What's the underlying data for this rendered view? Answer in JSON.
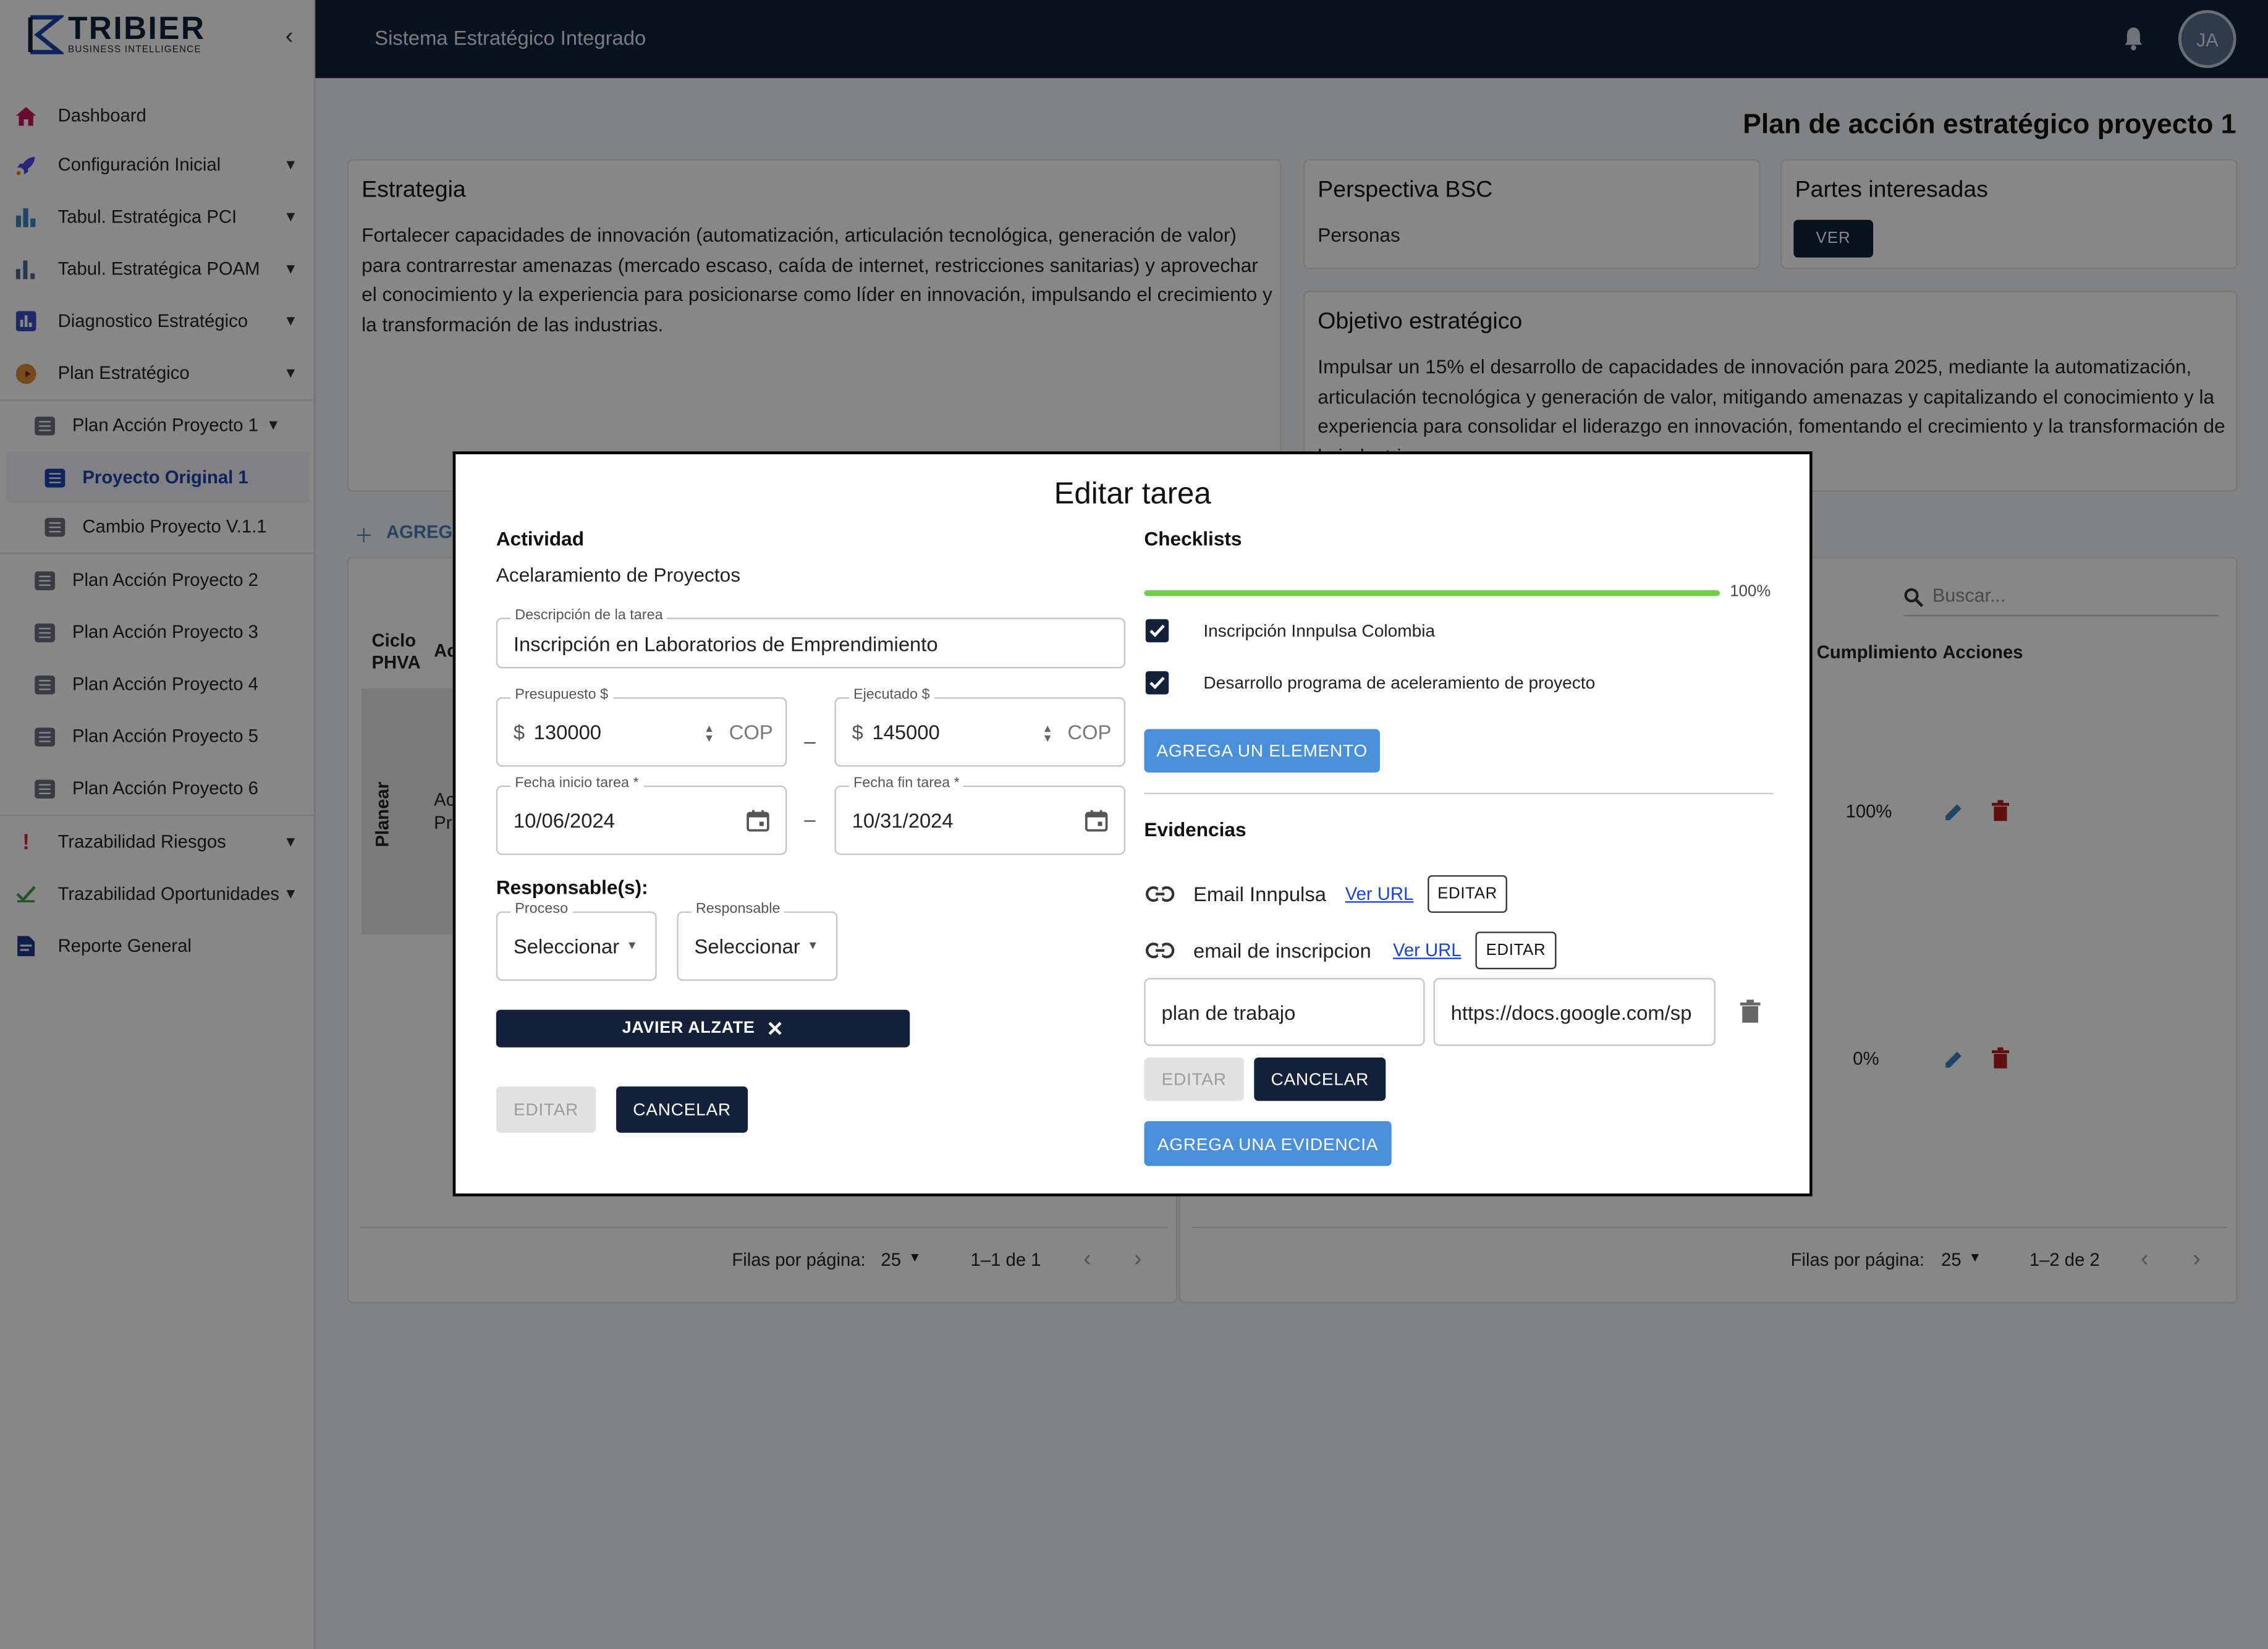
{
  "app": {
    "logo_name": "TRIBIER",
    "logo_sub": "BUSINESS INTELLIGENCE",
    "top_title": "Sistema Estratégico Integrado",
    "avatar_initials": "JA"
  },
  "sidebar": {
    "items": [
      {
        "label": "Dashboard"
      },
      {
        "label": "Configuración Inicial"
      },
      {
        "label": "Tabul. Estratégica PCI"
      },
      {
        "label": "Tabul. Estratégica POAM"
      },
      {
        "label": "Diagnostico Estratégico"
      },
      {
        "label": "Plan Estratégico"
      },
      {
        "label": "Plan Acción Proyecto 1"
      },
      {
        "label": "Proyecto Original 1"
      },
      {
        "label": "Cambio Proyecto V.1.1"
      },
      {
        "label": "Plan Acción Proyecto 2"
      },
      {
        "label": "Plan Acción Proyecto 3"
      },
      {
        "label": "Plan Acción Proyecto 4"
      },
      {
        "label": "Plan Acción Proyecto 5"
      },
      {
        "label": "Plan Acción Proyecto 6"
      },
      {
        "label": "Trazabilidad Riesgos"
      },
      {
        "label": "Trazabilidad Oportunidades"
      },
      {
        "label": "Reporte General"
      }
    ]
  },
  "main": {
    "page_title": "Plan de acción estratégico proyecto 1",
    "estrategia": {
      "title": "Estrategia",
      "text": "Fortalecer capacidades de innovación (automatización, articulación tecnológica, generación de valor) para contrarrestar amenazas (mercado escaso, caída de internet, restricciones sanitarias) y aprovechar el conocimiento y la experiencia para posicionarse como líder en innovación, impulsando el crecimiento y la transformación de las industrias."
    },
    "perspectiva": {
      "title": "Perspectiva BSC",
      "value": "Personas"
    },
    "partes": {
      "title": "Partes interesadas",
      "button": "VER"
    },
    "objetivo": {
      "title": "Objetivo estratégico",
      "text": "Impulsar un 15% el desarrollo de capacidades de innovación para 2025, mediante la automatización, articulación tecnológica y generación de valor, mitigando amenazas y capitalizando el conocimiento y la experiencia para consolidar el liderazgo en innovación, fomentando el crecimiento y la transformación de la industria."
    },
    "add_label": "AGREGA",
    "left_table": {
      "col_ciclo": "Ciclo PHVA",
      "col_act": "Ac",
      "row_phase": "Planear",
      "row_text_1": "Ac",
      "row_text_2": "Pr",
      "rows_per_page_label": "Filas por página:",
      "rows_per_page": "25",
      "range": "1–1 de 1"
    },
    "right_table": {
      "search_placeholder": "Buscar...",
      "col_cumplimiento": "Cumplimiento",
      "col_acciones": "Acciones",
      "row1_cumplimiento": "100%",
      "row2_cumplimiento": "0%",
      "rows_per_page_label": "Filas por página:",
      "rows_per_page": "25",
      "range": "1–2 de 2"
    }
  },
  "modal": {
    "title": "Editar tarea",
    "actividad_label": "Actividad",
    "actividad_value": "Acelaramiento de Proyectos",
    "descripcion": {
      "label": "Descripción de la tarea",
      "value": "Inscripción en Laboratorios de Emprendimiento"
    },
    "presupuesto": {
      "label": "Presupuesto $",
      "prefix": "$",
      "value": "130000",
      "currency": "COP"
    },
    "ejecutado": {
      "label": "Ejecutado $",
      "prefix": "$",
      "value": "145000",
      "currency": "COP"
    },
    "fecha_inicio": {
      "label": "Fecha inicio tarea *",
      "value": "10/06/2024"
    },
    "fecha_fin": {
      "label": "Fecha fin tarea *",
      "value": "10/31/2024"
    },
    "responsables_label": "Responsable(s):",
    "proceso": {
      "label": "Proceso",
      "value": "Seleccionar"
    },
    "responsable": {
      "label": "Responsable",
      "value": "Seleccionar"
    },
    "chip_label": "JAVIER ALZATE",
    "edit_button": "EDITAR",
    "cancel_button": "CANCELAR",
    "checklists": {
      "title": "Checklists",
      "progress": 100,
      "progress_label": "100%",
      "items": [
        {
          "label": "Inscripción Innpulsa Colombia",
          "checked": true
        },
        {
          "label": "Desarrollo programa de aceleramiento de proyecto",
          "checked": true
        }
      ],
      "add_button": "AGREGA UN ELEMENTO"
    },
    "evidencias": {
      "title": "Evidencias",
      "items": [
        {
          "name": "Email Innpulsa",
          "link": "Ver URL",
          "edit": "EDITAR"
        },
        {
          "name": "email de inscripcion",
          "link": "Ver URL",
          "edit": "EDITAR"
        }
      ],
      "edit_name_value": "plan de trabajo",
      "edit_url_value": "https://docs.google.com/sp",
      "edit_button": "EDITAR",
      "cancel_button": "CANCELAR",
      "add_button": "AGREGA UNA EVIDENCIA"
    }
  },
  "colors": {
    "navy": "#13213b",
    "accent_blue": "#4a90d9",
    "progress_green": "#6ed04a",
    "active_blue": "#1e40af"
  }
}
